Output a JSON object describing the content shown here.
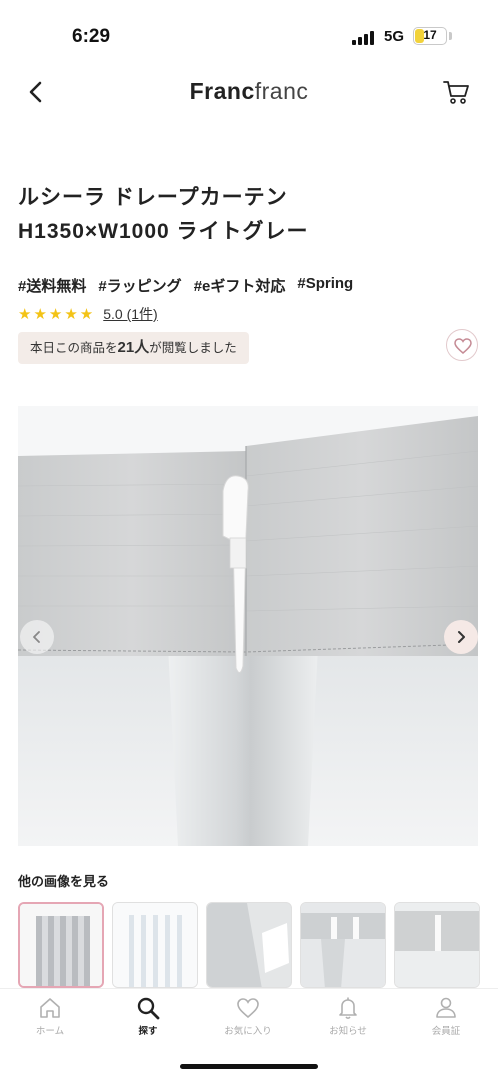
{
  "status_bar": {
    "time": "6:29",
    "network": "5G",
    "battery_level": "17",
    "battery_color": "#f2d23a"
  },
  "header": {
    "brand_bold": "Franc",
    "brand_light": "franc",
    "back_icon": "chevron-left-icon",
    "cart_icon": "cart-icon"
  },
  "product": {
    "title_line1": "ルシーラ ドレープカーテン",
    "title_line2": "H1350×W1000 ライトグレー",
    "tags": [
      "#送料無料",
      "#ラッピング",
      "#eギフト対応",
      "#Spring"
    ],
    "stars": "★★★★★",
    "rating_text": "5.0 (1件)",
    "views_prefix": "本日この商品を",
    "views_count": "21人",
    "views_suffix": "が閲覧しました",
    "star_color": "#f3c316"
  },
  "gallery": {
    "other_images_label": "他の画像を見る",
    "prev_icon": "chevron-left-icon",
    "next_icon": "chevron-right-icon"
  },
  "tabbar": {
    "items": [
      {
        "label": "ホーム",
        "icon": "home-icon",
        "active": false
      },
      {
        "label": "探す",
        "icon": "search-icon",
        "active": true
      },
      {
        "label": "お気に入り",
        "icon": "heart-icon",
        "active": false
      },
      {
        "label": "お知らせ",
        "icon": "bell-icon",
        "active": false
      },
      {
        "label": "会員証",
        "icon": "member-card-icon",
        "active": false
      }
    ]
  }
}
